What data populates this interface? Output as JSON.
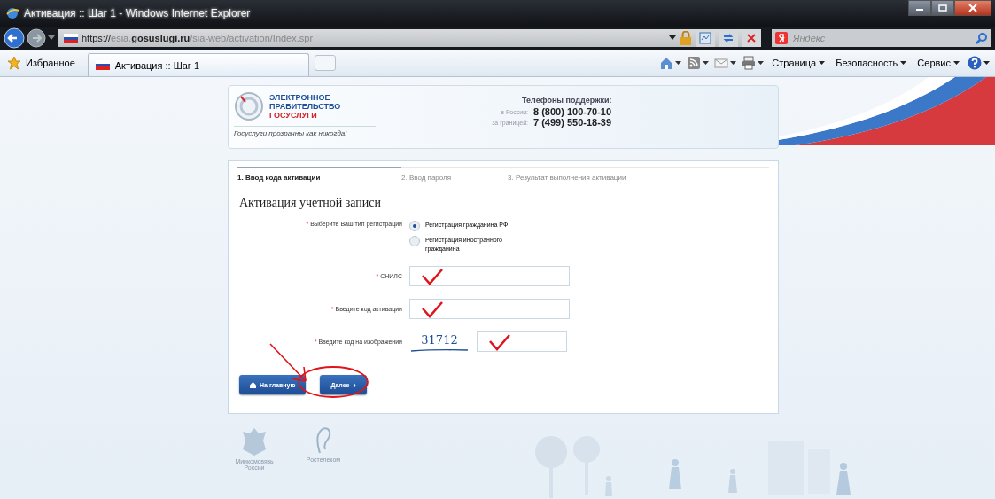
{
  "window": {
    "title": "Активация :: Шаг 1 - Windows Internet Explorer"
  },
  "address_bar": {
    "scheme": "https://",
    "host_prefix": "esia.",
    "domain": "gosuslugi.ru",
    "path": "/sia-web/activation/Index.spr"
  },
  "search": {
    "placeholder": "Яндекс"
  },
  "favorites": {
    "label": "Избранное"
  },
  "tabs": [
    {
      "label": "Активация :: Шаг 1",
      "selected": true
    }
  ],
  "commands": [
    {
      "label": "Страница"
    },
    {
      "label": "Безопасность"
    },
    {
      "label": "Сервис"
    }
  ],
  "header": {
    "logo_lines": [
      "ЭЛЕКТРОННОЕ",
      "ПРАВИТЕЛЬСТВО",
      "ГОСУСЛУГИ"
    ],
    "slogan": "Госуслуги прозрачны как никогда!",
    "support_title": "Телефоны поддержки:",
    "phones": [
      {
        "label": "в России:",
        "number": "8 (800) 100-70-10"
      },
      {
        "label": "за границей:",
        "number": "7 (499) 550-18-39"
      }
    ]
  },
  "steps": [
    {
      "label": "1. Ввод кода активации",
      "selected": true
    },
    {
      "label": "2. Ввод пароля",
      "selected": false
    },
    {
      "label": "3. Результат выполнения активации",
      "selected": false
    }
  ],
  "form": {
    "title": "Активация учетной записи",
    "registration_type": {
      "mark": "*",
      "label": "Выберите Ваш тип регистрации",
      "options": [
        {
          "label": "Регистрация гражданина РФ",
          "selected": true
        },
        {
          "label": "Регистрация иностранного гражданина",
          "selected": false
        }
      ]
    },
    "fields": [
      {
        "kind": "text",
        "mark": "*",
        "label": "СНИЛС"
      },
      {
        "kind": "text",
        "mark": "*",
        "label": "Введите код активации"
      },
      {
        "kind": "captcha",
        "mark": "*",
        "label": "Введите код на изображении",
        "captcha": "31712"
      }
    ],
    "buttons": [
      {
        "kind": "home",
        "label": "На главную"
      },
      {
        "kind": "next",
        "label": "Далее",
        "symbol": "›"
      }
    ]
  },
  "footer": {
    "logos": [
      {
        "kind": "emblem",
        "caption": "Минкомсвязь России"
      },
      {
        "kind": "ear",
        "caption": "Ростелеком"
      }
    ]
  }
}
